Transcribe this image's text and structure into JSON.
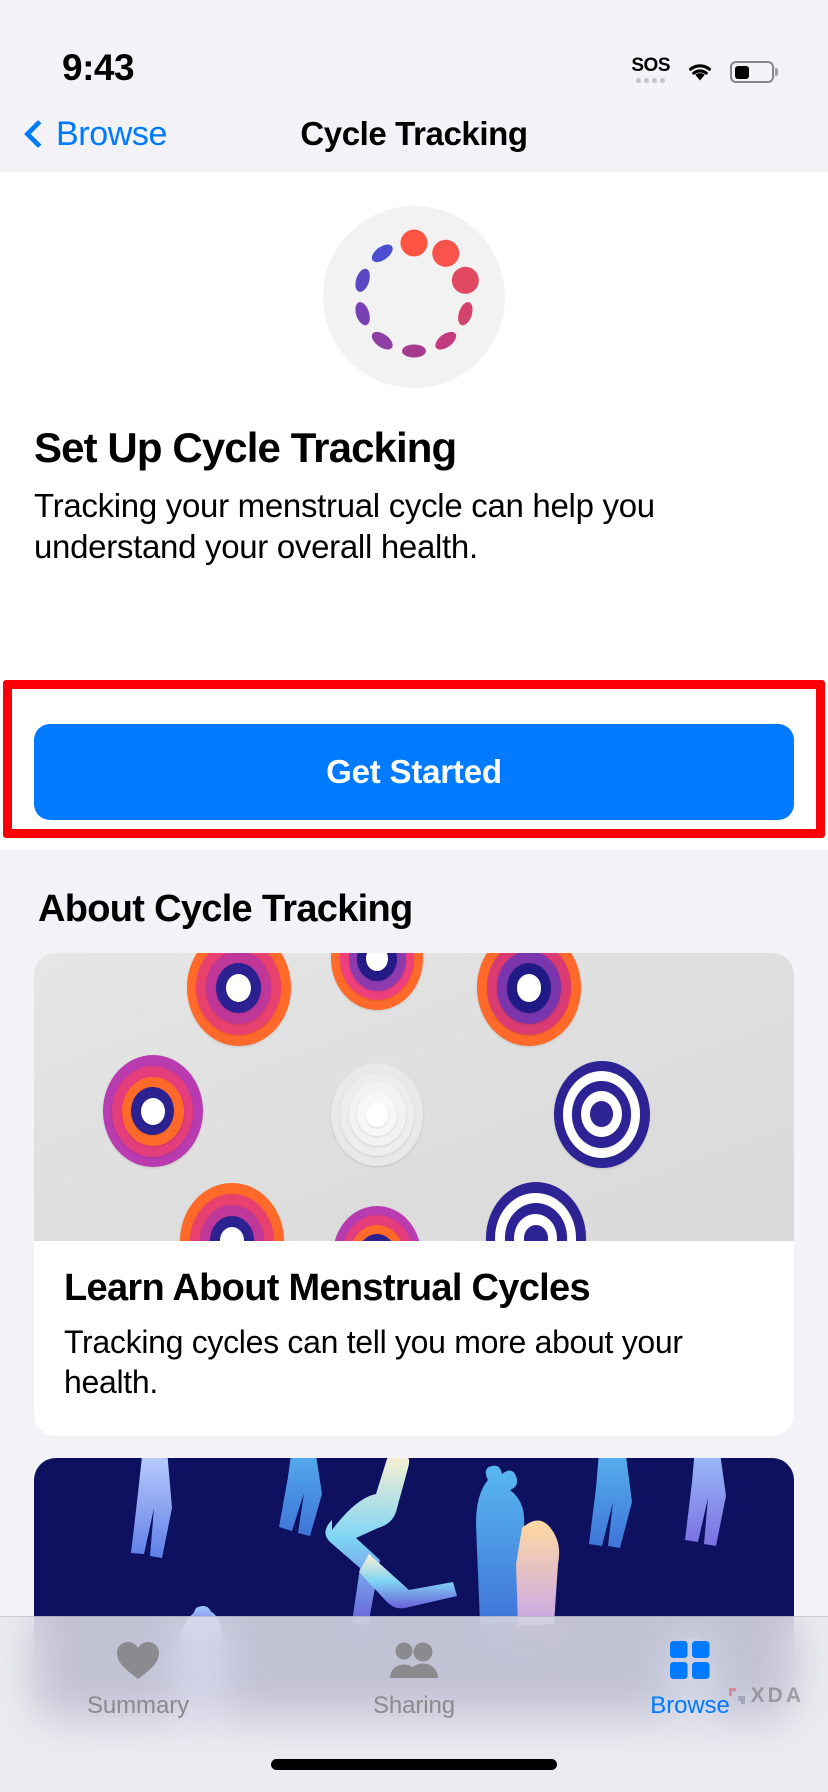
{
  "status_bar": {
    "time": "9:43",
    "sos_label": "SOS",
    "wifi_icon": "wifi-icon",
    "battery_icon": "battery-icon",
    "battery_level_pct": 42
  },
  "nav": {
    "back_label": "Browse",
    "back_icon": "chevron-left-icon",
    "title": "Cycle Tracking"
  },
  "hero": {
    "icon_name": "cycle-tracking-icon",
    "title": "Set Up Cycle Tracking",
    "description": "Tracking your menstrual cycle can help you understand your overall health.",
    "cta_label": "Get Started"
  },
  "annotation": {
    "color": "#fb0007",
    "target": "get-started-button"
  },
  "about": {
    "section_title": "About Cycle Tracking",
    "cards": [
      {
        "art_name": "concentric-cycle-rings-art",
        "title": "Learn About Menstrual Cycles",
        "subtitle": "Tracking cycles can tell you more about your health."
      },
      {
        "art_name": "people-silhouettes-art",
        "title": "",
        "subtitle": ""
      }
    ]
  },
  "tab_bar": {
    "items": [
      {
        "label": "Summary",
        "icon": "heart-icon",
        "active": false
      },
      {
        "label": "Sharing",
        "icon": "people-icon",
        "active": false
      },
      {
        "label": "Browse",
        "icon": "grid-icon",
        "active": true
      }
    ]
  },
  "watermark": {
    "text": "XDA"
  },
  "colors": {
    "accent": "#007aff",
    "background": "#f2f2f7",
    "card": "#ffffff",
    "annotation": "#fb0007",
    "dark_card": "#0d1160"
  }
}
